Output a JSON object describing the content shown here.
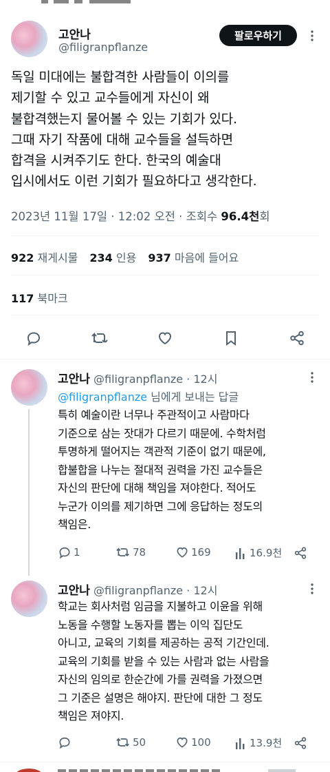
{
  "top_cut_text": "",
  "tweet": {
    "name": "고안나",
    "handle": "@filigranpflanze",
    "follow_label": "팔로우하기",
    "body_lines": [
      "독일 미대에는 불합격한 사람들이 이의를",
      "제기할 수 있고 교수들에게 자신이 왜",
      "불합격했는지 물어볼 수 있는 기회가 있다.",
      "그때 자기 작품에 대해 교수들을 설득하면",
      "합격을 시켜주기도 한다. 한국의 예술대",
      "입시에서도 이런 기회가 필요하다고 생각한다."
    ],
    "timestamp": "2023년 11월 17일 · 12:02 오전 · 조회수 ",
    "views": "96.4천",
    "views_suffix": "회",
    "stats": {
      "reposts_num": "922",
      "reposts_label": "재게시물",
      "quotes_num": "234",
      "quotes_label": "인용",
      "likes_num": "937",
      "likes_label": "마음에 들어요",
      "bookmarks_num": "117",
      "bookmarks_label": "북마크"
    },
    "actions": [
      "reply-icon",
      "repost-icon",
      "like-icon",
      "bookmark-icon",
      "share-icon"
    ]
  },
  "replies": [
    {
      "name": "고안나",
      "handle": "@filigranpflanze · 12시",
      "reply_to_handle": "@filigranpflanze",
      "reply_to_suffix": " 님에게 보내는 답글",
      "lines": [
        "특히 예술이란 너무나 주관적이고 사람마다",
        "기준으로 삼는 잣대가 다르기 때문에. 수학처럼",
        "투명하게 떨어지는 객관적 기준이 없기 때문에,",
        "합불합을 나누는 절대적 권력을 가진 교수들은",
        "자신의 판단에 대해 책임을 져야한다. 적어도",
        "누군가 이의를 제기하면 그에 응답하는 정도의",
        "책임은."
      ],
      "reply_count": "1",
      "repost_count": "78",
      "like_count": "169",
      "view_count": "16.9천"
    },
    {
      "name": "고안나",
      "handle": "@filigranpflanze · 12시",
      "lines": [
        "학교는 회사처럼 임금을 지불하고 이윤을 위해",
        "노동을 수행할 노동자를 뽑는 이익 집단도",
        "아니고, 교육의 기회를 제공하는 공적 기간인데.",
        "교육의 기회를 받을 수 있는 사람과 없는 사람을",
        "자신의 임의로 한순간에 가를 권력을 가졌으면",
        "그 기준은 설명은 해야지. 판단에 대한 그 정도",
        "책임은 져야지."
      ],
      "reply_count": "",
      "repost_count": "50",
      "like_count": "100",
      "view_count": "13.9천"
    }
  ],
  "colors": {
    "text": "#0f1419",
    "secondary": "#536471",
    "link": "#1d9bf0",
    "divider": "#eff3f4"
  }
}
